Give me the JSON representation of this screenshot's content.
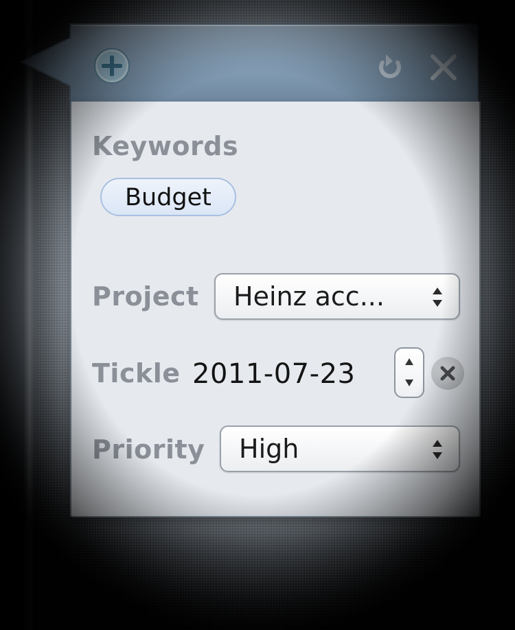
{
  "header": {
    "add_icon": "plus-circle",
    "undo_icon": "undo-arrow",
    "close_icon": "x-mark",
    "accent": "#7e95ac"
  },
  "keywords": {
    "label": "Keywords",
    "items": [
      "Budget"
    ]
  },
  "project": {
    "label": "Project",
    "value": "Heinz acc..."
  },
  "tickle": {
    "label": "Tickle",
    "value": "2011-07-23"
  },
  "priority": {
    "label": "Priority",
    "value": "High"
  }
}
